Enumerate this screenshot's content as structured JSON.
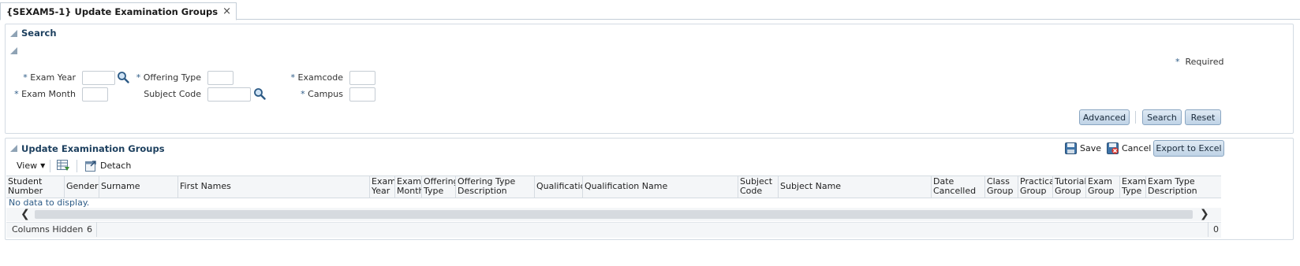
{
  "tab": {
    "title": "{SEXAM5-1} Update Examination Groups",
    "close_glyph": "×"
  },
  "search": {
    "title": "Search",
    "required_note": "Required",
    "star": "*",
    "fields": {
      "exam_year": "Exam Year",
      "exam_month": "Exam Month",
      "offering_type": "Offering Type",
      "subject_code": "Subject Code",
      "examcode": "Examcode",
      "campus": "Campus"
    },
    "buttons": {
      "advanced": "Advanced",
      "search": "Search",
      "reset": "Reset"
    }
  },
  "results": {
    "title": "Update Examination Groups",
    "save": "Save",
    "cancel": "Cancel",
    "export": "Export to Excel",
    "view": "View",
    "detach": "Detach",
    "columns": [
      "Student Number",
      "Gender",
      "Surname",
      "First Names",
      "Exam Year",
      "Exam Month",
      "Offering Type",
      "Offering Type Description",
      "Qualification",
      "Qualification Name",
      "Subject Code",
      "Subject Name",
      "Date Cancelled",
      "Class Group",
      "Practical Group",
      "Tutorial Group",
      "Exam Group",
      "Exam Type",
      "Exam Type Description"
    ],
    "no_data": "No data to display.",
    "columns_hidden_label": "Columns Hidden",
    "columns_hidden_count": "6",
    "row_count": "0"
  },
  "colors": {
    "accent": "#1c3f5e",
    "button": "#bfd3e6",
    "border": "#d3dbe3"
  }
}
